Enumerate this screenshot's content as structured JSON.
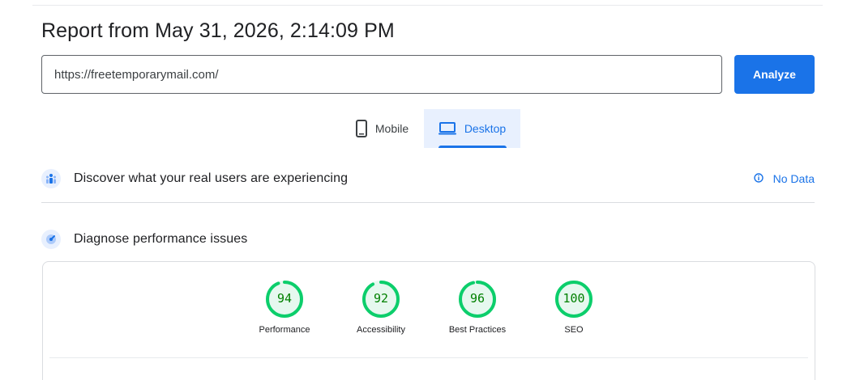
{
  "report": {
    "title": "Report from May 31, 2026, 2:14:09 PM"
  },
  "url_input": {
    "value": "https://freetemporarymail.com/"
  },
  "analyze_button": {
    "label": "Analyze"
  },
  "device_tabs": [
    {
      "label": "Mobile",
      "icon": "smartphone-icon",
      "selected": false
    },
    {
      "label": "Desktop",
      "icon": "laptop-icon",
      "selected": true
    }
  ],
  "field_data": {
    "heading": "Discover what your real users are experiencing",
    "status": "No Data",
    "status_icon": "info-icon"
  },
  "lab_data": {
    "heading": "Diagnose performance issues"
  },
  "scores": [
    {
      "label": "Performance",
      "value": "94",
      "fraction": 0.94
    },
    {
      "label": "Accessibility",
      "value": "92",
      "fraction": 0.92
    },
    {
      "label": "Best Practices",
      "value": "96",
      "fraction": 0.96
    },
    {
      "label": "SEO",
      "value": "100",
      "fraction": 1.0
    }
  ],
  "colors": {
    "accent": "#1a73e8",
    "score_good_stroke": "#0cce6b",
    "score_good_fill": "#e6f8ef",
    "score_good_text": "#008000"
  }
}
